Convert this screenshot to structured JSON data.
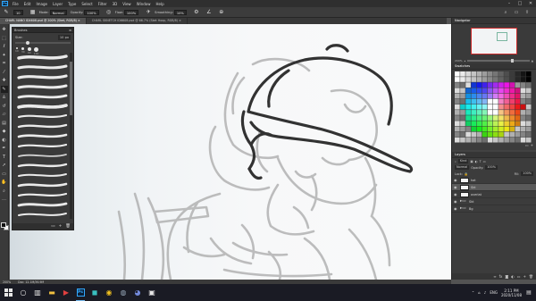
{
  "menubar": {
    "logo": "Ps",
    "items": [
      "File",
      "Edit",
      "Image",
      "Layer",
      "Type",
      "Select",
      "Filter",
      "3D",
      "View",
      "Window",
      "Help"
    ]
  },
  "options": {
    "size_value": "10",
    "mode_label": "Mode:",
    "mode_value": "Normal",
    "opacity_label": "Opacity:",
    "opacity_value": "100%",
    "flow_label": "Flow:",
    "flow_value": "100%",
    "smoothing_label": "Smoothing:",
    "smoothing_value": "10%"
  },
  "tabs": [
    {
      "label": "CHARL NANO ID4608.psd @ 200% (Sket, RGB/8) ×",
      "active": true
    },
    {
      "label": "CHARL SKNETCH ID6608.psd @ 66.7% (Sket Hoop, RGB/8) ×",
      "active": false
    }
  ],
  "brushes_panel": {
    "title": "Brushes",
    "size_label": "Size:",
    "size_value": "10 px",
    "presets": [
      "10",
      "30",
      "40",
      "100"
    ]
  },
  "navigator": {
    "title": "Navigator",
    "zoom": "200%"
  },
  "swatches": {
    "title": "Swatches"
  },
  "layers": {
    "title": "Layers",
    "tab2": "Channels",
    "tab3": "Paths",
    "kind_label": "Kind",
    "blend_mode": "Normal",
    "opacity_label": "Opacity:",
    "opacity_value": "100%",
    "lock_label": "Lock:",
    "fill_label": "Fill:",
    "fill_value": "100%",
    "items": [
      {
        "name": "hat",
        "type": "layer",
        "selected": false
      },
      {
        "name": "Skt",
        "type": "layer",
        "selected": true
      },
      {
        "name": "overlat",
        "type": "layer",
        "selected": false
      },
      {
        "name": "Skt",
        "type": "group",
        "selected": false
      },
      {
        "name": "Bg",
        "type": "group",
        "selected": false
      }
    ]
  },
  "statusbar": {
    "zoom": "200%",
    "doc": "Doc: 12.1M/36.9M"
  },
  "taskbar": {
    "time": "2:11 PM",
    "date": "2020/11/08",
    "lang": "ENG"
  },
  "colors": {
    "ps_blue": "#31a8ff",
    "canvas_bg": "#f7f8f9",
    "sketch_dark": "#3a3a3a",
    "sketch_light": "#b0b0b0"
  }
}
